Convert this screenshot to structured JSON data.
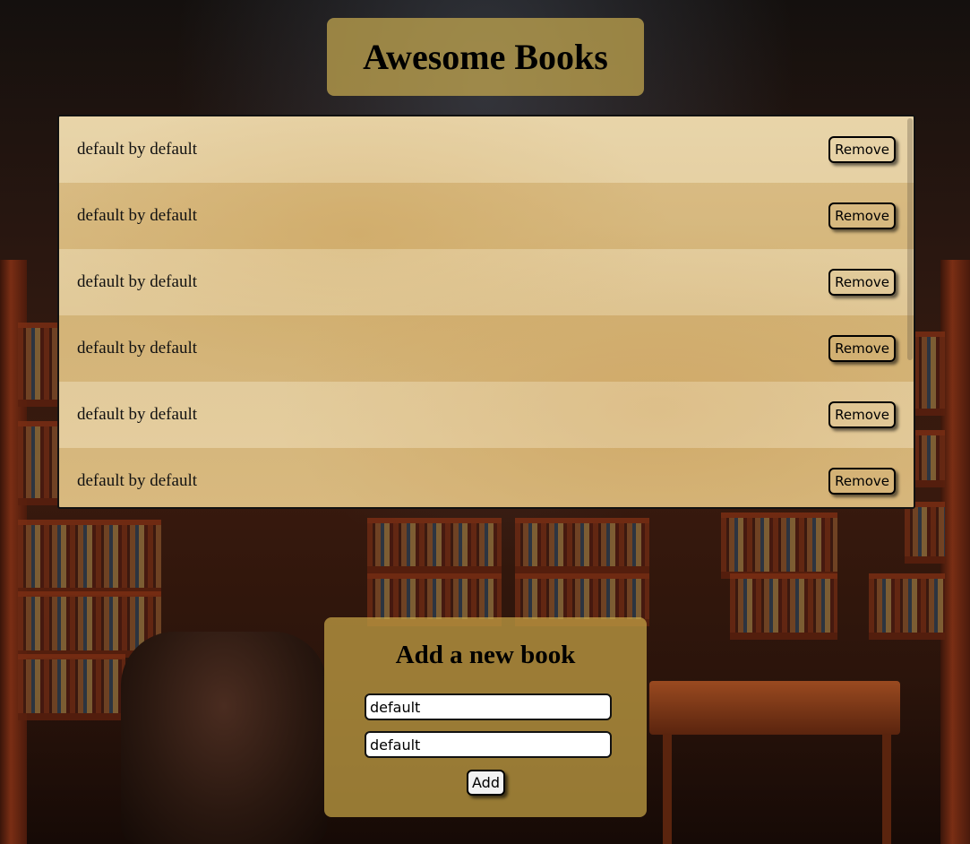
{
  "header": {
    "title": "Awesome Books"
  },
  "books": [
    {
      "text": "default by default",
      "remove_label": "Remove"
    },
    {
      "text": "default by default",
      "remove_label": "Remove"
    },
    {
      "text": "default by default",
      "remove_label": "Remove"
    },
    {
      "text": "default by default",
      "remove_label": "Remove"
    },
    {
      "text": "default by default",
      "remove_label": "Remove"
    },
    {
      "text": "default by default",
      "remove_label": "Remove"
    }
  ],
  "add_form": {
    "heading": "Add a new book",
    "title_value": "default",
    "author_value": "default",
    "add_label": "Add"
  },
  "colors": {
    "panel": "#c8a550",
    "list_bg": "#e2c996"
  }
}
